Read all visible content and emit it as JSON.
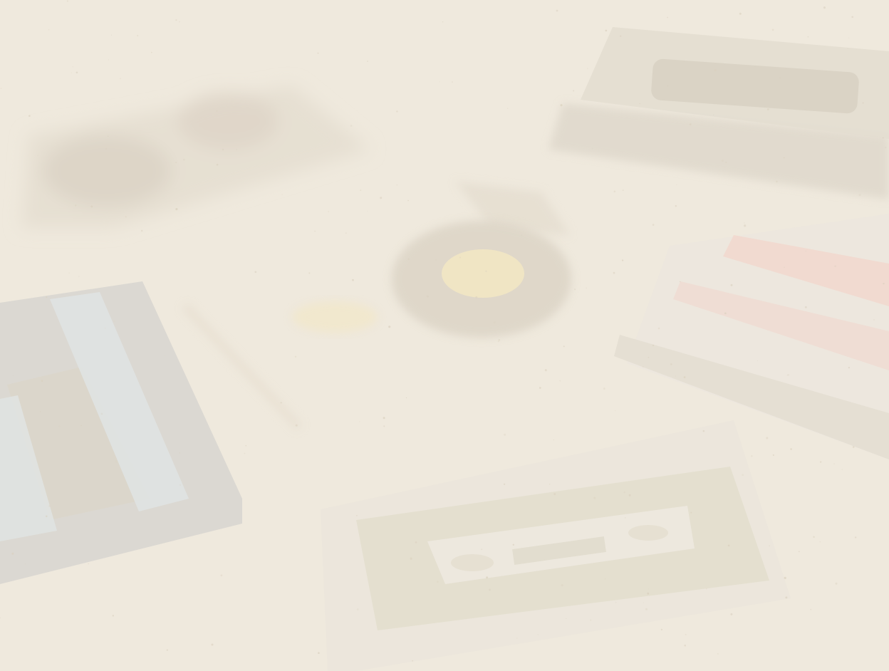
{
  "scene": {
    "background_color": "#efe9dd",
    "speckle_color": "#d9cfbd",
    "objects": [
      {
        "name": "cassette-top-right",
        "kind": "cassette",
        "body_color": "#e3ddd0",
        "window_color": "#d8d1c3",
        "shadow_color": "#d6cfc2"
      },
      {
        "name": "cassette-top-left-blurred",
        "kind": "cassette",
        "body_color": "#e6dfd2",
        "reel_color": "#dcd4c6"
      },
      {
        "name": "vinyl-record",
        "kind": "record",
        "disc_color": "#ddd5c7",
        "label_color": "#f1e6c4"
      },
      {
        "name": "record-player-tonearm",
        "kind": "tonearm",
        "color": "#e5ddcf"
      },
      {
        "name": "cassette-left-gray",
        "kind": "cassette",
        "body_color": "#d8d6d0",
        "stripe_color": "#dfe3e2",
        "inner_color": "#dcd6ca"
      },
      {
        "name": "cassette-right-striped",
        "kind": "cassette",
        "body_color": "#ece7dd",
        "stripe_colors": [
          "#f1d9cf",
          "#efdcd3"
        ],
        "strip_color": "#e3ded2"
      },
      {
        "name": "cassette-bottom-center",
        "kind": "cassette",
        "body_color": "#ebe6db",
        "label_color": "#e4dfcf",
        "window_color": "#ede8de"
      }
    ]
  }
}
